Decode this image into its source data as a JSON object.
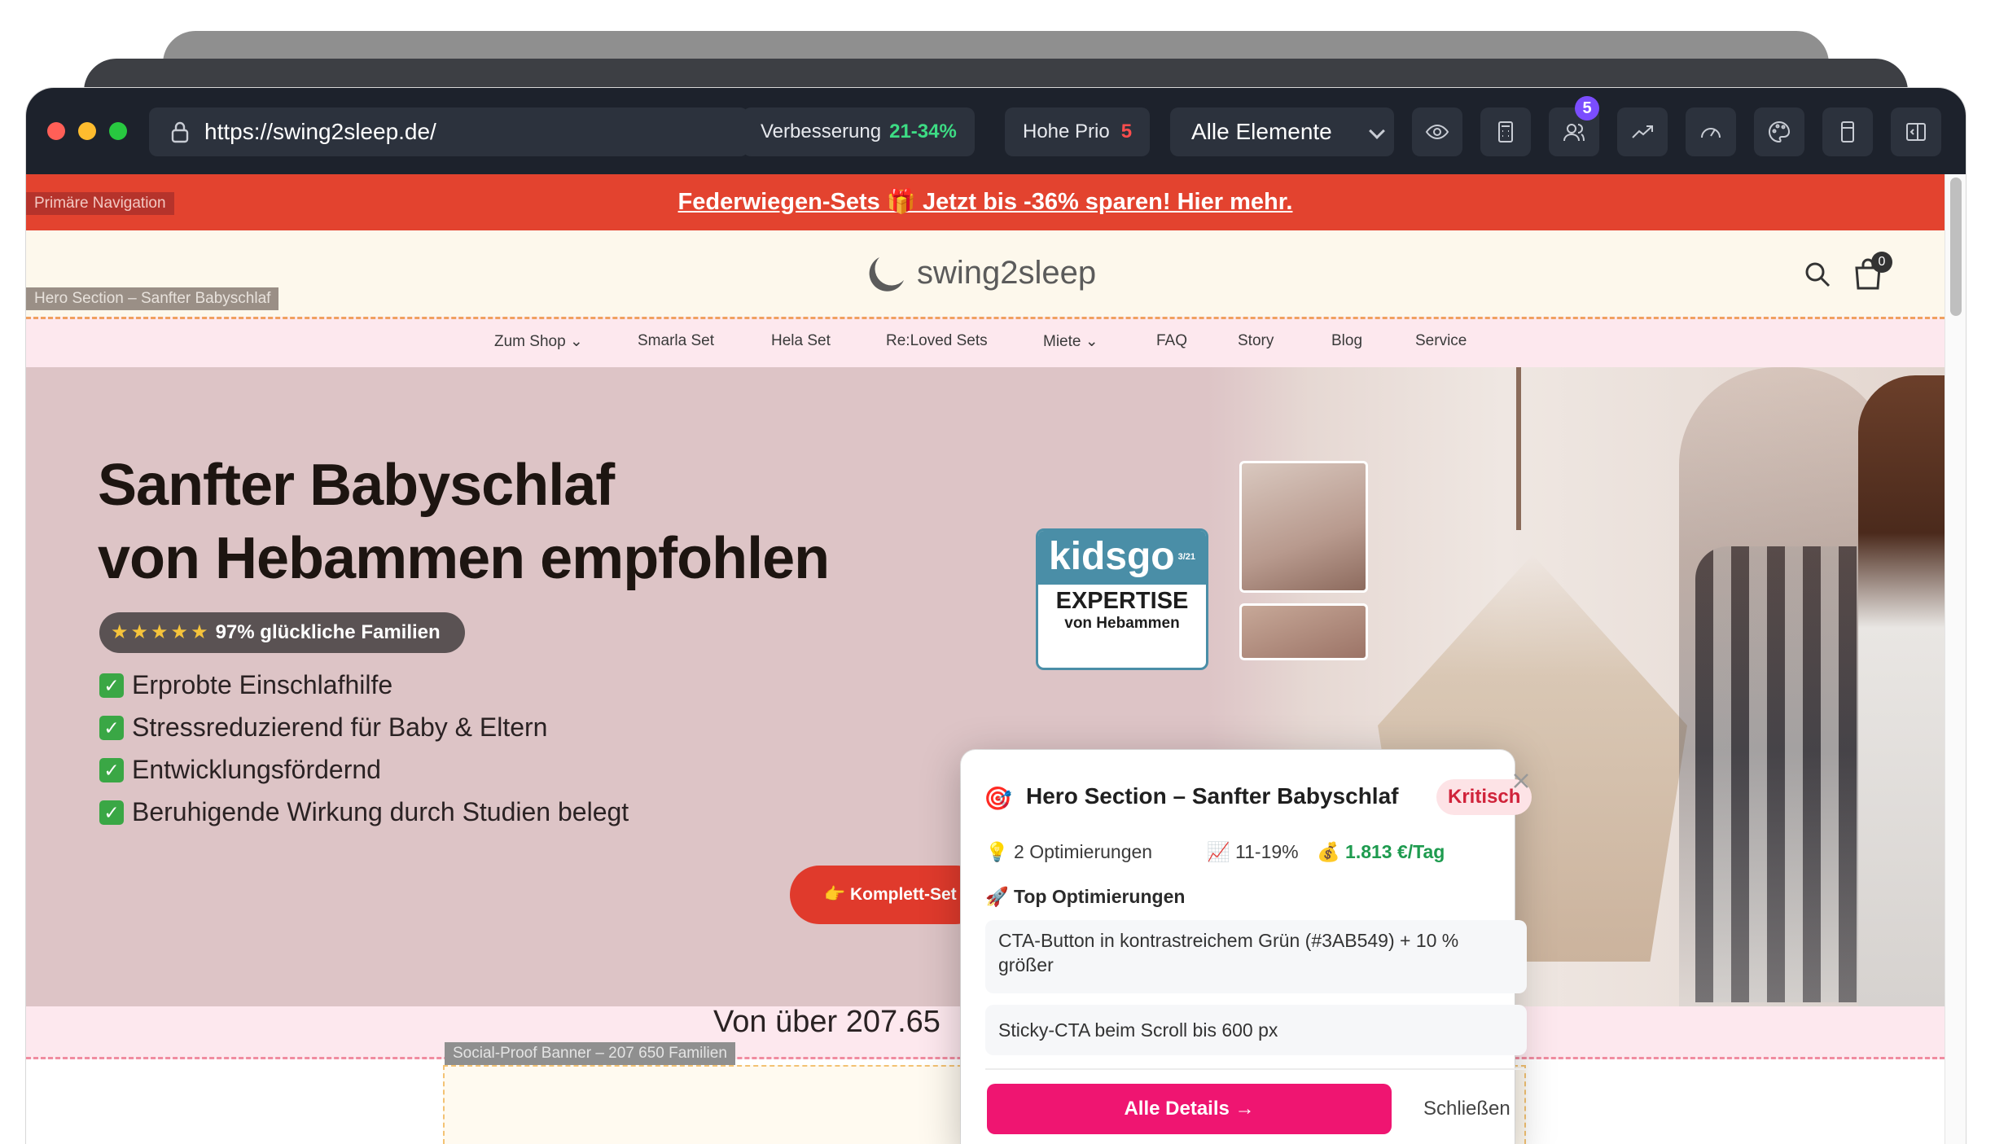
{
  "toolbar": {
    "url": "https://swing2sleep.de/",
    "improvement_label": "Verbesserung",
    "improvement_value": "21-34%",
    "priority_label": "Hohe Prio",
    "priority_value": "5",
    "filter_select": "Alle Elemente",
    "user_badge": "5",
    "icons": [
      "eye-icon",
      "calculator-icon",
      "users-icon",
      "trend-icon",
      "gauge-icon",
      "palette-icon",
      "bookmark-icon",
      "sidebar-icon"
    ]
  },
  "page": {
    "promo": "Federwiegen-Sets 🎁 Jetzt bis -36% sparen! Hier mehr.",
    "logo": "swing2sleep",
    "cart_count": "0",
    "nav": [
      "Zum Shop ⌄",
      "Smarla Set",
      "Hela Set",
      "Re:Loved Sets",
      "Miete ⌄",
      "FAQ",
      "Story",
      "Blog",
      "Service"
    ],
    "hero": {
      "title1": "Sanfter Babyschlaf",
      "title2": "von Hebammen empfohlen",
      "stars": "★★★★★",
      "rating": "97% glückliche Familien",
      "bullets": [
        "Erprobte Einschlafhilfe",
        "Stressreduzierend für Baby & Eltern",
        "Entwicklungsfördernd",
        "Beruhigende Wirkung durch Studien belegt"
      ],
      "cta": "👉 Komplett-Set",
      "badge_brand": "kidsgo",
      "badge_date": "3/21",
      "badge_title": "EXPERTISE",
      "badge_sub": "von Hebammen"
    },
    "social_heading": "Von über 207.65",
    "overlay_tags": {
      "nav": "Primäre Navigation",
      "hero": "Hero Section – Sanfter Babyschlaf",
      "social": "Social-Proof Banner – 207 650 Familien"
    }
  },
  "popup": {
    "icon": "🎯",
    "title": "Hero Section – Sanfter Babyschlaf",
    "severity": "Kritisch",
    "optimizations": "💡 2 Optimierungen",
    "range": "📈 11-19%",
    "revenue": "💰 1.813 €/Tag",
    "section_title": "🚀 Top Optimierungen",
    "items": [
      "CTA-Button in kontrastreichem Grün (#3AB549) + 10 % größer",
      "Sticky-CTA beim Scroll bis 600 px"
    ],
    "primary_button": "Alle Details →",
    "secondary_button": "Schließen"
  },
  "colors": {
    "accent": "#ef1571",
    "promo": "#e3432f",
    "hero_bg": "#ddc4c6",
    "toolbar": "#1d222c",
    "positive": "#3ddc84"
  }
}
